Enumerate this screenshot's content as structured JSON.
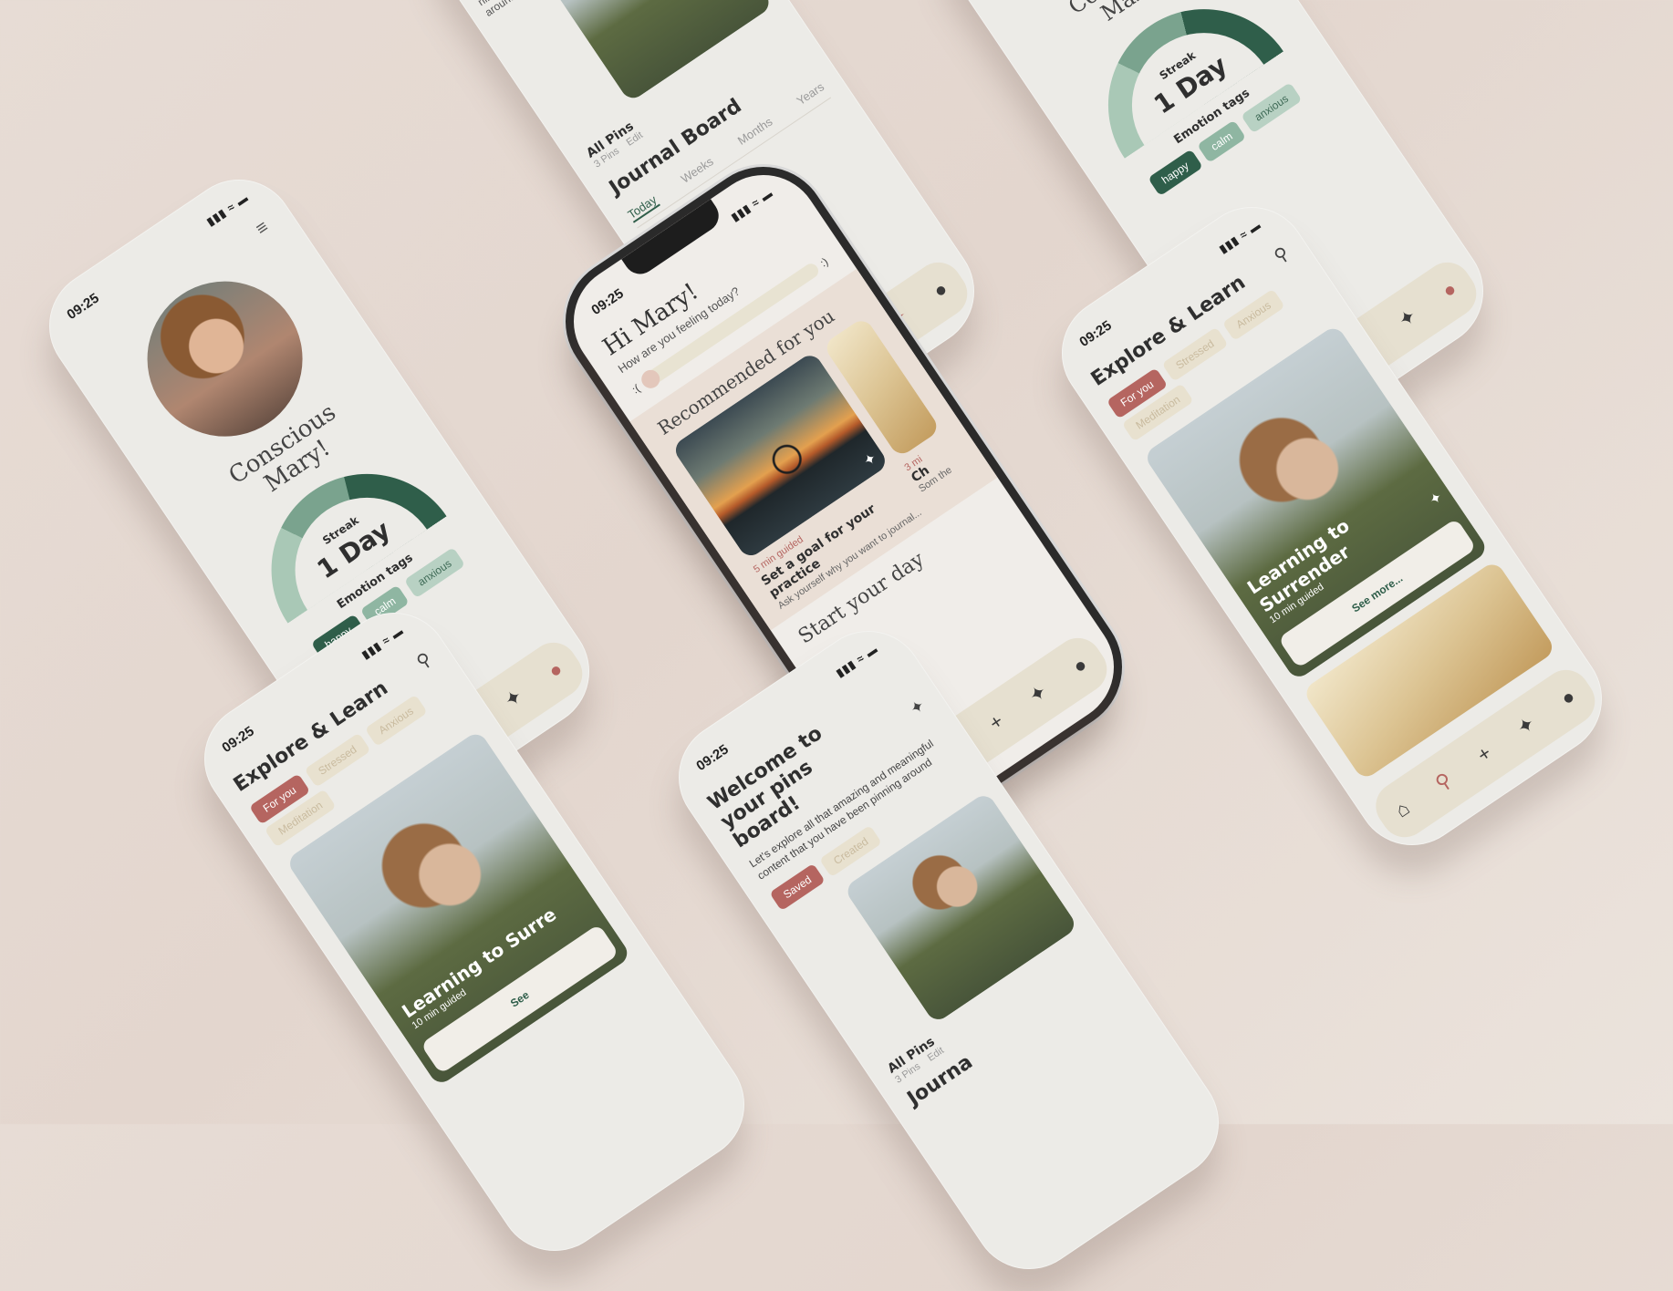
{
  "status_time": "09:25",
  "nav_icons": [
    "home-icon",
    "search-icon",
    "plus-icon",
    "pin-icon",
    "profile-icon"
  ],
  "colors": {
    "accent": "#b56560",
    "dark_green": "#2f5e4a",
    "mid_green": "#7aa38e",
    "light_green": "#a9c8b6",
    "cream": "#e6e0d0",
    "background": "#e7dcd5"
  },
  "home": {
    "greeting": "Hi Mary!",
    "question": "How are you feeling today?",
    "mood_left": ":(",
    "mood_right": ":)",
    "recommended_title": "Recommended for you",
    "card1": {
      "duration": "5 min guided",
      "title": "Set a goal for your practice",
      "subtitle": "Ask yourself why you want to journal..."
    },
    "card2": {
      "duration": "3 mi",
      "title": "Ch",
      "subtitle": "Som the"
    },
    "start_title": "Start your day"
  },
  "profile": {
    "name_line1": "Conscious",
    "name_line2": "Mary!",
    "streak_label": "Streak",
    "streak_value": "1 Day",
    "emotion_tags_label": "Emotion tags",
    "tags": [
      "happy",
      "calm",
      "anxious"
    ]
  },
  "journal": {
    "partial_text_1": "ningful",
    "partial_text_2": "around",
    "all_pins_label": "All Pins",
    "pins_count": "3 Pins",
    "edit_label": "Edit",
    "title": "Journal Board",
    "tabs": [
      "Today",
      "Weeks",
      "Months",
      "Years"
    ]
  },
  "explore": {
    "title": "Explore & Learn",
    "filters": [
      "For you",
      "Stressed",
      "Anxious",
      "Meditation"
    ],
    "feature_title": "Learning to Surrender",
    "feature_duration": "10 min guided",
    "see_more": "See more..."
  },
  "explore_bottom": {
    "feature_title": "Learning to Surre",
    "feature_duration": "10 min guided",
    "see_more": "See"
  },
  "pins_board": {
    "title": "Welcome to your pins board!",
    "description": "Let's explore all that amazing and meaningful content that you have been pinning around",
    "tabs": [
      "Saved",
      "Created"
    ],
    "all_pins_label": "All Pins",
    "pins_count": "3 Pins",
    "edit_label": "Edit",
    "partial_title": "Journa"
  }
}
